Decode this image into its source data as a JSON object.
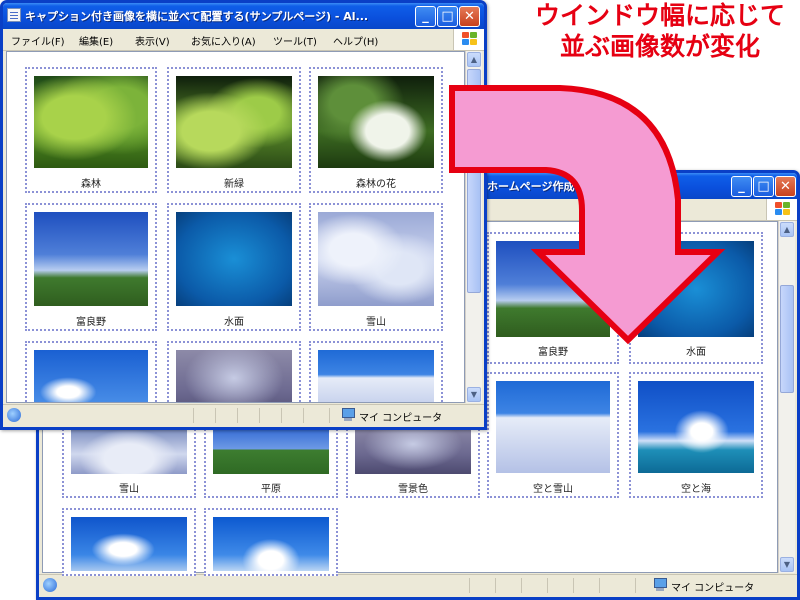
{
  "heading": {
    "line1": "ウインドウ幅に応じて",
    "line2": "並ぶ画像数が変化"
  },
  "front_window": {
    "title": "キャプション付き画像を横に並べて配置する(サンプルページ) - Al...",
    "menus": [
      "ファイル(F)",
      "編集(E)",
      "表示(V)",
      "お気に入り(A)",
      "ツール(T)",
      "ヘルプ(H)"
    ],
    "status_text": "マイ コンピュータ",
    "tiles": [
      {
        "caption": "森林",
        "image": "forest"
      },
      {
        "caption": "新緑",
        "image": "fresh-green"
      },
      {
        "caption": "森林の花",
        "image": "forest-flower"
      },
      {
        "caption": "富良野",
        "image": "furano"
      },
      {
        "caption": "水面",
        "image": "water-surface"
      },
      {
        "caption": "雪山",
        "image": "snow-mountain"
      },
      {
        "caption": "",
        "image": "sky"
      },
      {
        "caption": "",
        "image": "snowy-trees"
      },
      {
        "caption": "",
        "image": "sky-snow"
      }
    ]
  },
  "back_window": {
    "title": "ホームページ作成 - ... Intern...",
    "status_text": "マイ コンピュータ",
    "tiles": [
      {
        "caption": "富良野",
        "image": "furano"
      },
      {
        "caption": "水面",
        "image": "water-surface"
      },
      {
        "caption": "雪山",
        "image": "snow-mountain"
      },
      {
        "caption": "平原",
        "image": "plain"
      },
      {
        "caption": "雪景色",
        "image": "snowscape"
      },
      {
        "caption": "空と雪山",
        "image": "sky-snow-mountain"
      },
      {
        "caption": "空と海",
        "image": "sky-sea"
      },
      {
        "caption": "",
        "image": "sky-cloud"
      },
      {
        "caption": "",
        "image": "blue-sky"
      }
    ]
  },
  "colors": {
    "heading": "#e60012",
    "arrow_fill": "#f59bd2",
    "arrow_stroke": "#e60012",
    "tile_border": "#8c92d6",
    "title_bar": "#0a4fdc"
  }
}
